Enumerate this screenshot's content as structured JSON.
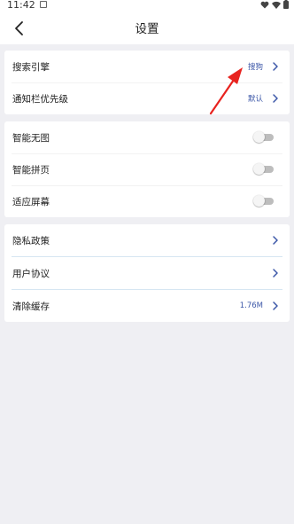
{
  "status_bar": {
    "time": "11:42",
    "icons": [
      "notification-icon",
      "heart-icon",
      "wifi-icon",
      "battery-icon"
    ]
  },
  "header": {
    "title": "设置",
    "back_icon": "chevron-left-icon"
  },
  "groups": [
    {
      "rows": [
        {
          "label": "搜索引擎",
          "value": "搜狗",
          "type": "link"
        },
        {
          "label": "通知栏优先级",
          "value": "默认",
          "type": "link"
        }
      ]
    },
    {
      "rows": [
        {
          "label": "智能无图",
          "type": "toggle",
          "enabled": false
        },
        {
          "label": "智能拼页",
          "type": "toggle",
          "enabled": false
        },
        {
          "label": "适应屏幕",
          "type": "toggle",
          "enabled": false
        }
      ]
    },
    {
      "rows": [
        {
          "label": "隐私政策",
          "type": "link"
        },
        {
          "label": "用户协议",
          "type": "link"
        },
        {
          "label": "清除缓存",
          "value": "1.76M",
          "type": "link"
        }
      ]
    }
  ],
  "colors": {
    "accent": "#3c57a8",
    "background": "#efeff3",
    "annotation_arrow": "#e8231f"
  }
}
